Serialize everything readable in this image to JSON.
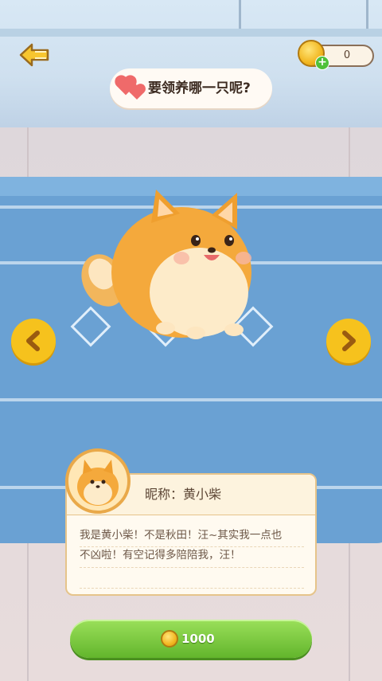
{
  "header": {
    "coins": "0",
    "title": "要领养哪一只呢?"
  },
  "pet": {
    "nickname": "昵称：黄小柴",
    "description_line1": "我是黄小柴！不是秋田！汪~其实我一点也",
    "description_line2": "不凶啦！有空记得多陪陪我，汪！"
  },
  "adopt": {
    "price": "1000"
  },
  "colors": {
    "accent_yellow": "#f6c21d",
    "button_green": "#62b52c",
    "rug_blue": "#6aa1d3"
  },
  "icons": [
    "back-arrow-icon",
    "coin-icon",
    "plus-icon",
    "heart-icon",
    "chevron-left-icon",
    "chevron-right-icon"
  ]
}
